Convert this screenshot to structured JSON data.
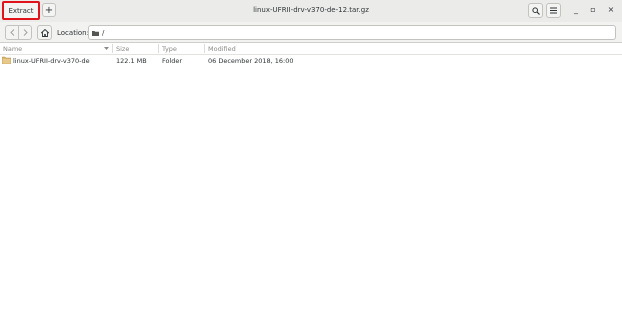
{
  "window": {
    "title": "linux-UFRII-drv-v370-de-12.tar.gz",
    "extract_label": "Extract",
    "add_label": "+",
    "minimize_label": "_",
    "maximize_label": "▫",
    "close_label": "×"
  },
  "toolbar": {
    "location_label": "Location:",
    "location_value": "/"
  },
  "columns": {
    "name": "Name",
    "size": "Size",
    "type": "Type",
    "modified": "Modified"
  },
  "files": [
    {
      "name": "linux-UFRII-drv-v370-de",
      "size": "122.1 MB",
      "type": "Folder",
      "modified": "06 December 2018, 16:00",
      "icon": "folder-icon"
    }
  ],
  "colors": {
    "highlight": "#e0131a",
    "folder": "#d9b56f"
  }
}
